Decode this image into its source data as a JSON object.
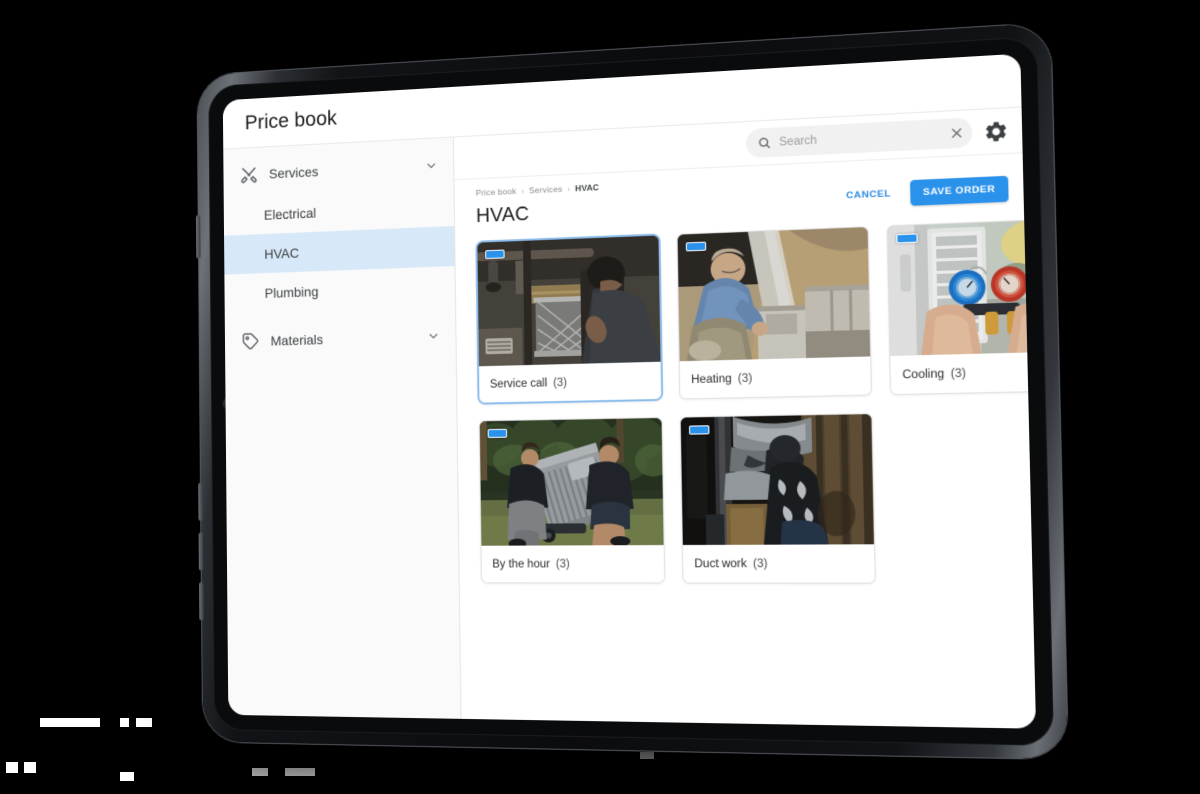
{
  "app": {
    "title": "Price book"
  },
  "search": {
    "placeholder": "Search",
    "value": "",
    "search_icon": "search-icon",
    "clear_icon": "close-icon",
    "settings_icon": "gear-icon"
  },
  "sidebar": {
    "groups": [
      {
        "label": "Services",
        "icon": "tools-icon",
        "expanded": true,
        "chevron": "chevron-down-icon",
        "items": [
          {
            "label": "Electrical",
            "active": false
          },
          {
            "label": "HVAC",
            "active": true
          },
          {
            "label": "Plumbing",
            "active": false
          }
        ]
      },
      {
        "label": "Materials",
        "icon": "tag-icon",
        "expanded": false,
        "chevron": "chevron-down-icon",
        "items": []
      }
    ]
  },
  "content": {
    "breadcrumb": [
      {
        "label": "Price book",
        "current": false
      },
      {
        "label": "Services",
        "current": false
      },
      {
        "label": "HVAC",
        "current": true
      }
    ],
    "breadcrumb_separator": "›",
    "page_title": "HVAC",
    "actions": {
      "cancel_label": "CANCEL",
      "save_label": "SAVE ORDER"
    },
    "cards": [
      {
        "label": "Service call",
        "count": "(3)",
        "selected": true,
        "image": "hvac-filter-replacement-photo"
      },
      {
        "label": "Heating",
        "count": "(3)",
        "selected": false,
        "image": "attic-furnace-technician-photo"
      },
      {
        "label": "Cooling",
        "count": "(3)",
        "selected": false,
        "image": "refrigerant-manifold-gauges-photo"
      },
      {
        "label": "By the hour",
        "count": "(3)",
        "selected": false,
        "image": "workers-moving-condenser-photo"
      },
      {
        "label": "Duct work",
        "count": "(3)",
        "selected": false,
        "image": "duct-insulation-worker-photo"
      }
    ]
  },
  "colors": {
    "accent": "#2b92ec",
    "accent_text": "#2b8ae2",
    "nav_active_bg": "#d7e8f8",
    "card_selected_border": "#8cbdec",
    "background": "#000000",
    "device_bezel": "#1b1e22"
  }
}
